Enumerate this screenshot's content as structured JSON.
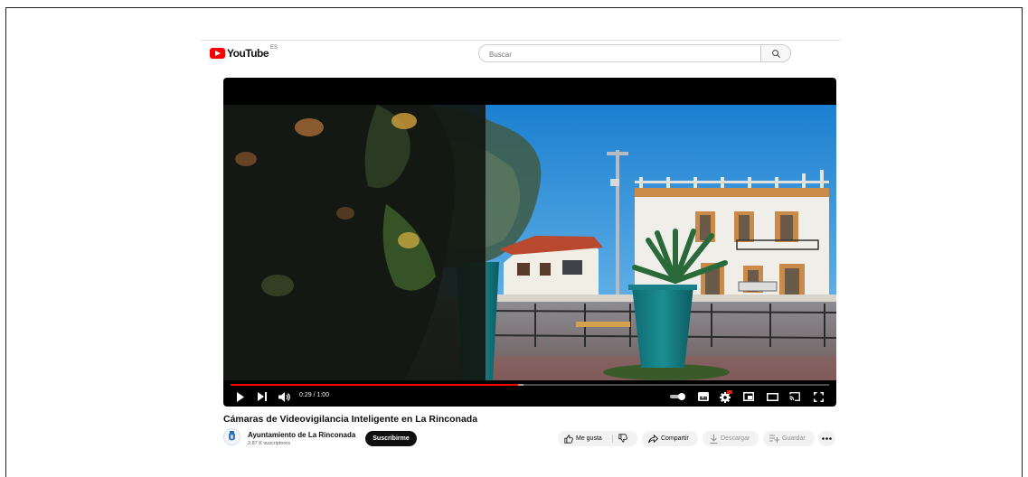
{
  "header": {
    "logo_text": "YouTube",
    "logo_region": "ES",
    "search_placeholder": "Buscar"
  },
  "player": {
    "time_display": "0:29 / 1:00",
    "progress_fraction": 0.48,
    "buffered_fraction": 0.49
  },
  "video": {
    "title": "Cámaras de Videovigilancia Inteligente en La Rinconada"
  },
  "channel": {
    "name": "Ayuntamiento de La Rinconada",
    "subscribers": "2,87 K suscriptores",
    "subscribe_label": "Suscribirme"
  },
  "actions": {
    "like_label": "Me gusta",
    "share_label": "Compartir",
    "download_label": "Descargar",
    "save_label": "Guardar"
  },
  "colors": {
    "brand_red": "#ff0000",
    "subscribe_bg": "#0f0f0f",
    "pill_bg": "#f2f2f2"
  }
}
